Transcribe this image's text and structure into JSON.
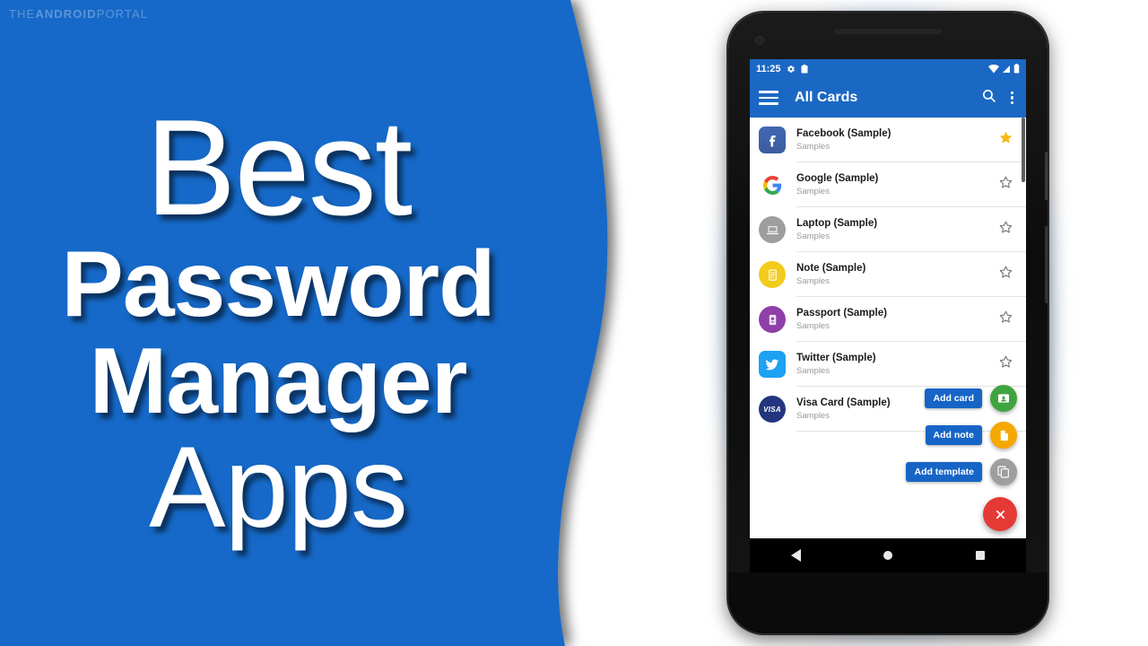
{
  "watermark": {
    "part1": "THE",
    "part2": "ANDROID",
    "part3": "PORTAL"
  },
  "theme": {
    "brand_blue": "#1669C8",
    "appbar_blue": "#1B68C4",
    "chip_blue": "#1665C6",
    "fab_red": "#E53935",
    "fab_green": "#3FA43F",
    "fab_amber": "#F5A800",
    "fab_gray": "#9E9E9E",
    "star_gold": "#F5B919"
  },
  "headline": {
    "line1": "Best",
    "line2": "Password",
    "line3": "Manager",
    "line4": "Apps"
  },
  "phone": {
    "statusbar": {
      "time": "11:25",
      "icons_left": [
        "gear-icon",
        "clipboard-icon"
      ],
      "icons_right": [
        "wifi-icon",
        "signal-icon",
        "battery-icon"
      ]
    },
    "appbar": {
      "menu_icon": "hamburger-icon",
      "title": "All Cards",
      "search_icon": "search-icon",
      "overflow_icon": "more-vert-icon"
    },
    "list": [
      {
        "title": "Facebook (Sample)",
        "subtitle": "Samples",
        "icon": "facebook-icon",
        "starred": true
      },
      {
        "title": "Google (Sample)",
        "subtitle": "Samples",
        "icon": "google-icon",
        "starred": false
      },
      {
        "title": "Laptop (Sample)",
        "subtitle": "Samples",
        "icon": "laptop-icon",
        "starred": false
      },
      {
        "title": "Note (Sample)",
        "subtitle": "Samples",
        "icon": "note-icon",
        "starred": false
      },
      {
        "title": "Passport (Sample)",
        "subtitle": "Samples",
        "icon": "passport-icon",
        "starred": false
      },
      {
        "title": "Twitter (Sample)",
        "subtitle": "Samples",
        "icon": "twitter-icon",
        "starred": false
      },
      {
        "title": "Visa Card (Sample)",
        "subtitle": "Samples",
        "icon": "visa-icon",
        "starred": false
      }
    ],
    "fab_menu": [
      {
        "label": "Add card",
        "icon": "contact-card-icon",
        "color": "#3FA43F"
      },
      {
        "label": "Add note",
        "icon": "note-page-icon",
        "color": "#F5A800"
      },
      {
        "label": "Add template",
        "icon": "copy-template-icon",
        "color": "#9E9E9E"
      }
    ],
    "fab_main": {
      "icon": "close-icon",
      "color": "#E53935"
    },
    "navbar": [
      "back-icon",
      "home-icon",
      "recents-icon"
    ]
  }
}
